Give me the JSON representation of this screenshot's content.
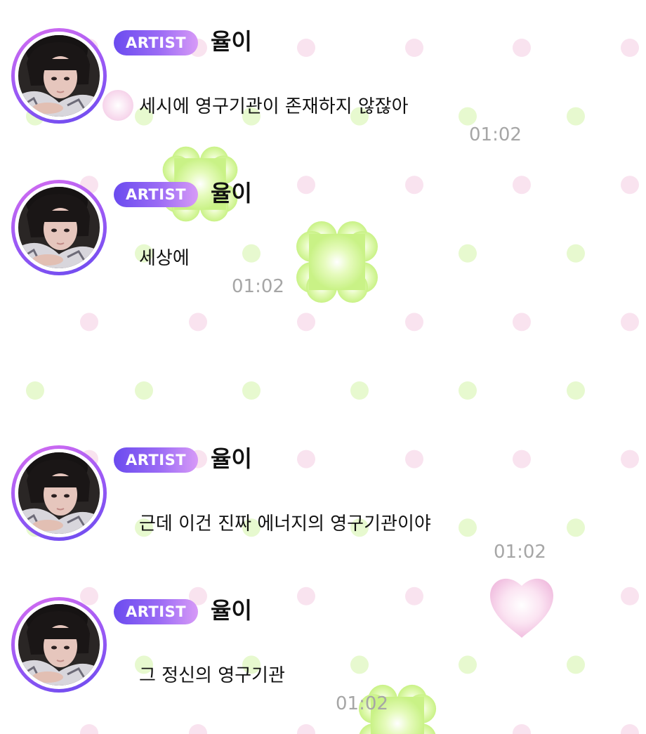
{
  "messages": [
    {
      "badge": "ARTIST",
      "sender": "율이",
      "text": "세시에 영구기관이 존재하지 않잖아",
      "time": "01:02"
    },
    {
      "badge": "ARTIST",
      "sender": "율이",
      "text": "세상에",
      "time": "01:02"
    },
    {
      "badge": "ARTIST",
      "sender": "율이",
      "text": "근데 이건 진짜 에너지의 영구기관이야",
      "time": "01:02"
    },
    {
      "badge": "ARTIST",
      "sender": "율이",
      "text": "그 정신의 영구기관",
      "time": "01:02"
    }
  ],
  "colors": {
    "badge_gradient_start": "#6a4bef",
    "badge_gradient_end": "#d79af7",
    "pink_dot": "#f9e3ef",
    "green_dot": "#e7f9cf",
    "clover": "#ccf58d",
    "heart": "#f3c6e4",
    "timestamp": "#a6a6a6"
  },
  "icons": {
    "background_pattern": "polka-dot-pattern",
    "decorations": [
      "clover-icon",
      "heart-icon"
    ]
  }
}
